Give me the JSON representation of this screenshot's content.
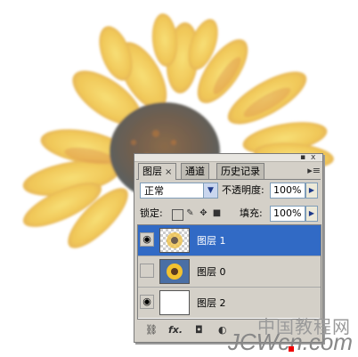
{
  "layers_panel": {
    "tabs": [
      {
        "label": "图层",
        "close": "×",
        "active": true
      },
      {
        "label": "通道",
        "active": false
      },
      {
        "label": "历史记录",
        "active": false
      }
    ],
    "window_buttons": {
      "minimize": "▪",
      "close": "x"
    },
    "menu_icon": "▸≡",
    "blend_mode": "正常",
    "opacity_label": "不透明度:",
    "opacity_value": "100%",
    "lock_label": "锁定:",
    "fill_label": "填充:",
    "fill_value": "100%",
    "layers": [
      {
        "name": "图层 1",
        "visible": true,
        "selected": true,
        "thumb": "checker-flower"
      },
      {
        "name": "图层 0",
        "visible": false,
        "selected": false,
        "thumb": "photo-flower"
      },
      {
        "name": "图层 2",
        "visible": true,
        "selected": false,
        "thumb": "white"
      }
    ],
    "footer_icons": [
      "link-icon",
      "fx-icon",
      "mask-icon",
      "adjustment-icon"
    ],
    "fx_label": "fx."
  },
  "watermark": {
    "cn_text": "中国教程网",
    "en_text": "JCWcn.com"
  },
  "colors": {
    "selection": "#316ac5",
    "panel_bg": "#d4d0c8",
    "petal": "#f0c84a",
    "center": "#6a5a4a"
  }
}
